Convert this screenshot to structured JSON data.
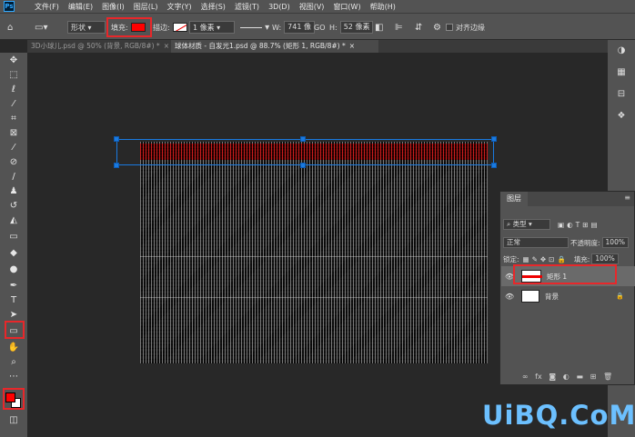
{
  "menu": {
    "logo": "Ps",
    "items": [
      "文件(F)",
      "编辑(E)",
      "图像(I)",
      "图层(L)",
      "文字(Y)",
      "选择(S)",
      "滤镜(T)",
      "3D(D)",
      "视图(V)",
      "窗口(W)",
      "帮助(H)"
    ]
  },
  "options": {
    "mode": "形状",
    "fill_label": "填充:",
    "fill_color": "#ff0000",
    "stroke_label": "描边:",
    "stroke_size": "1 像素",
    "w_label": "W:",
    "w_value": "741 像",
    "link_icon": "GO",
    "h_label": "H:",
    "h_value": "52 像素",
    "align_label": "对齐边缘"
  },
  "tabs": [
    {
      "label": "3D小球儿.psd @ 50% (背景, RGB/8#) *",
      "close": "×"
    },
    {
      "label": "球体材质 - 自发光1.psd @ 88.7% (矩形 1, RGB/8#) *",
      "close": "×"
    }
  ],
  "layers_panel": {
    "title": "图层",
    "filter_label": "类型",
    "blend_mode": "正常",
    "opacity_label": "不透明度:",
    "opacity_value": "100%",
    "lock_label": "锁定:",
    "fill_label": "填充:",
    "fill_value": "100%",
    "layers": [
      {
        "name": "矩形 1",
        "selected": true
      },
      {
        "name": "背景",
        "selected": false
      }
    ]
  },
  "colors": {
    "highlight": "#e8272a",
    "selection": "#1a7ae0",
    "foreground": "#ff0000",
    "background": "#ffffff"
  },
  "watermark": "UiBQ.CoM"
}
